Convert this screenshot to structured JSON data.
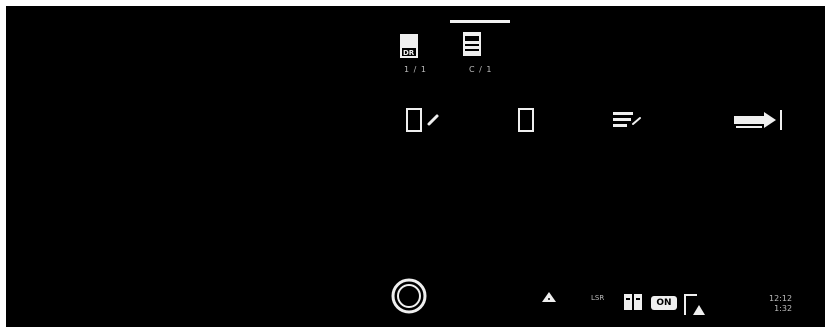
{
  "modes": [
    {
      "icon": "dr-document-icon",
      "label": "DR",
      "caption": "1 / 1"
    },
    {
      "icon": "tray-card-icon",
      "label": "",
      "caption": "C / 1"
    }
  ],
  "tools": [
    {
      "icon": "rect-pencil-icon"
    },
    {
      "icon": "rect-icon"
    },
    {
      "icon": "lines-pencil-icon"
    },
    {
      "icon": "arrow-exit-icon"
    }
  ],
  "status": {
    "label_left": "LSR",
    "badge": "ON",
    "time_line1": "12:12",
    "time_line2": "1:32"
  },
  "colors": {
    "screen_bg": "#000000",
    "fg": "#efefef",
    "muted": "#bdbdbd"
  }
}
